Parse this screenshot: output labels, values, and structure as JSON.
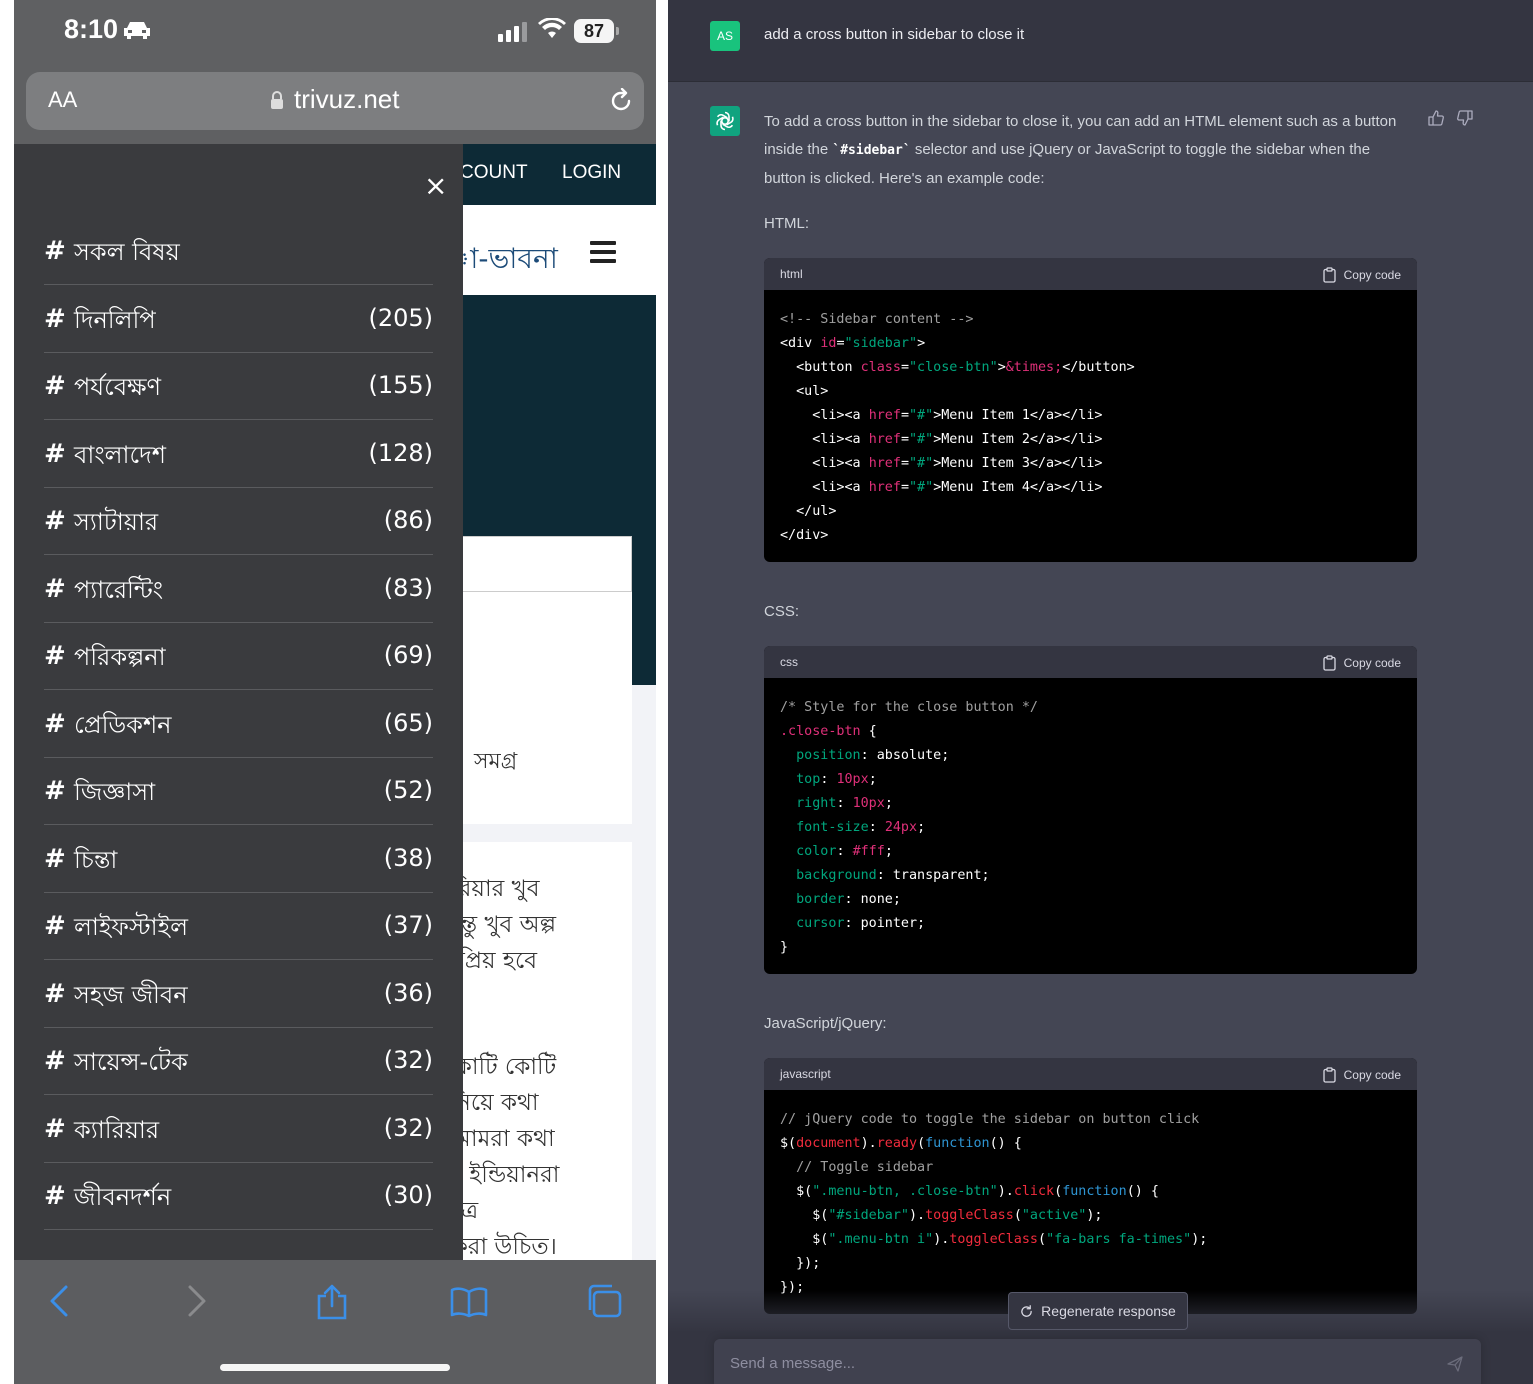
{
  "phone": {
    "status": {
      "time": "8:10",
      "battery": "87"
    },
    "url": {
      "aa_label": "AA",
      "host": "trivuz.net"
    },
    "web": {
      "nav_account": "COUNT",
      "nav_login": "LOGIN",
      "brand_partial": "া-ভাবনা",
      "card1_text": "সমগ্র",
      "card2_lines": [
        "ারিয়ার খুব",
        ", কিন্তু খুব অল্প",
        "জনপ্রিয় হবে",
        "খ কোটি কোটি",
        "টা নিয়ে কথা",
        "বা আমরা কথা",
        "করে ইন্ডিয়ানরা",
        "ক্ষেত্রে",
        "না করা উচিত।"
      ]
    },
    "sidebar": {
      "close_label": "×",
      "categories": [
        {
          "hash": "#",
          "name": "সকল বিষয়",
          "count": ""
        },
        {
          "hash": "#",
          "name": "দিনলিপি",
          "count": "(205)"
        },
        {
          "hash": "#",
          "name": "পর্যবেক্ষণ",
          "count": "(155)"
        },
        {
          "hash": "#",
          "name": "বাংলাদেশ",
          "count": "(128)"
        },
        {
          "hash": "#",
          "name": "স্যাটায়ার",
          "count": "(86)"
        },
        {
          "hash": "#",
          "name": "প্যারেন্টিং",
          "count": "(83)"
        },
        {
          "hash": "#",
          "name": "পরিকল্পনা",
          "count": "(69)"
        },
        {
          "hash": "#",
          "name": "প্রেডিকশন",
          "count": "(65)"
        },
        {
          "hash": "#",
          "name": "জিজ্ঞাসা",
          "count": "(52)"
        },
        {
          "hash": "#",
          "name": "চিন্তা",
          "count": "(38)"
        },
        {
          "hash": "#",
          "name": "লাইফস্টাইল",
          "count": "(37)"
        },
        {
          "hash": "#",
          "name": "সহজ জীবন",
          "count": "(36)"
        },
        {
          "hash": "#",
          "name": "সায়েন্স-টেক",
          "count": "(32)"
        },
        {
          "hash": "#",
          "name": "ক্যারিয়ার",
          "count": "(32)"
        },
        {
          "hash": "#",
          "name": "জীবনদর্শন",
          "count": "(30)"
        }
      ]
    },
    "toolbar": [
      "back-icon",
      "forward-icon",
      "share-icon",
      "bookmarks-icon",
      "tabs-icon"
    ]
  },
  "chat": {
    "user": {
      "avatar": "AS",
      "message": "add a cross button in sidebar to close it"
    },
    "assistant": {
      "intro_before": "To add a cross button in the sidebar to close it, you can add an HTML element such as a button inside the ",
      "intro_code": "`#sidebar`",
      "intro_after": " selector and use jQuery or JavaScript to toggle the sidebar when the button is clicked. Here's an example code:",
      "label_html": "HTML:",
      "label_css": "CSS:",
      "label_js": "JavaScript/jQuery:",
      "copy_label": "Copy code",
      "lang_html": "html",
      "lang_css": "css",
      "lang_js": "javascript"
    },
    "regenerate_label": "Regenerate response",
    "input_placeholder": "Send a message..."
  },
  "colors": {
    "chat_bg": "#444654",
    "user_bg": "#343541",
    "user_avatar": "#19c37d",
    "bot_avatar": "#10a37f",
    "sidebar_bg": "#3a3b3e"
  }
}
